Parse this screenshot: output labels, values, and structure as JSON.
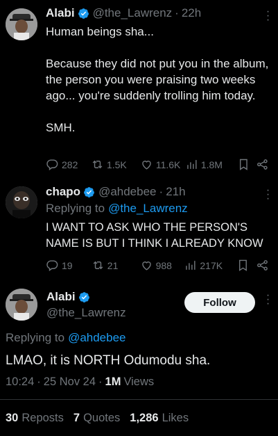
{
  "tweets": [
    {
      "name": "Alabi",
      "handle": "@the_Lawrenz",
      "time": "22h",
      "text": "Human beings sha...\n\nBecause they did not put you in the album, the person you were praising two weeks ago... you're suddenly trolling him today.\n\nSMH.",
      "stats": {
        "replies": "282",
        "reposts": "1.5K",
        "likes": "11.6K",
        "views": "1.8M"
      }
    },
    {
      "name": "chapo",
      "handle": "@ahdebee",
      "time": "21h",
      "replying_prefix": "Replying to",
      "replying_to": "@the_Lawrenz",
      "text": "I WANT TO ASK WHO THE PERSON'S NAME IS BUT I THINK I ALREADY KNOW",
      "stats": {
        "replies": "19",
        "reposts": "21",
        "likes": "988",
        "views": "217K"
      }
    }
  ],
  "main": {
    "name": "Alabi",
    "handle": "@the_Lawrenz",
    "follow_label": "Follow",
    "replying_prefix": "Replying to",
    "replying_to": "@ahdebee",
    "text": "LMAO, it is NORTH Odumodu sha.",
    "time": "10:24",
    "date": "25 Nov 24",
    "views_count": "1M",
    "views_label": "Views",
    "reposts_count": "30",
    "reposts_label": "Reposts",
    "quotes_count": "7",
    "quotes_label": "Quotes",
    "likes_count": "1,286",
    "likes_label": "Likes"
  },
  "ui": {
    "dot": "·",
    "more": "⋮"
  },
  "colors": {
    "accent": "#1d9bf0",
    "muted": "#71767b",
    "text": "#e7e9ea",
    "bg": "#000000"
  },
  "icons": [
    "verified-icon",
    "reply-icon",
    "repost-icon",
    "like-icon",
    "views-icon",
    "bookmark-icon",
    "share-icon",
    "more-icon"
  ]
}
